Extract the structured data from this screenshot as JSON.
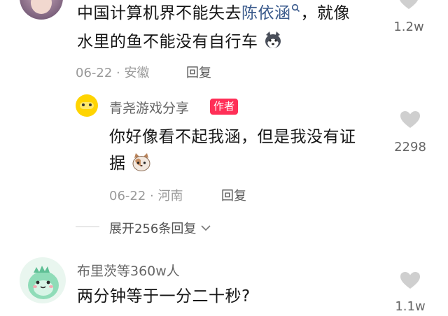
{
  "comment1": {
    "text_part1": "中国计算机界不能失去",
    "link_name": "陈依涵",
    "text_part2": "，就像",
    "line2": "水里的鱼不能没有自行车",
    "date": "06-22",
    "location": "安徽",
    "reply_label": "回复",
    "likes": "1.2w",
    "emoji": "husky-emoji-icon"
  },
  "reply1": {
    "author": "青尧游戏分享",
    "badge": "作者",
    "line1": "你好像看不起我涵，但是我没有证",
    "line2": "据",
    "date": "06-22",
    "location": "河南",
    "reply_label": "回复",
    "likes": "2298",
    "emoji": "cat-emoji-icon"
  },
  "expand": {
    "label": "展开256条回复"
  },
  "comment2": {
    "author": "布里茨等360w人",
    "text": "两分钟等于一分二十秒?",
    "likes": "1.1w"
  },
  "colors": {
    "link": "#3a5a8c",
    "author_badge": "#ff2f57",
    "meta_gray": "#9a9a9a"
  }
}
